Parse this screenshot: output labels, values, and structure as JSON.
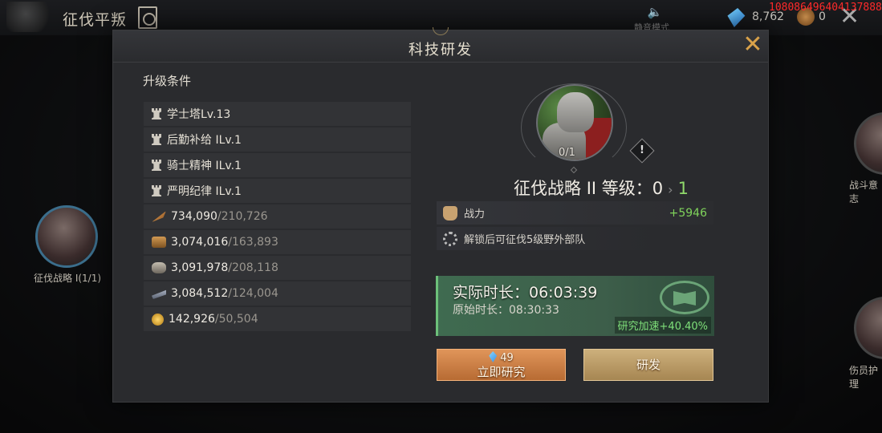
{
  "top_bar": {
    "title": "征伐平叛",
    "mute_label": "静音模式",
    "gems": "8,762",
    "coins": "0",
    "debug_id": "1080864964041378882"
  },
  "side_nodes": {
    "left_label": "征伐战略 I(1/1)",
    "right1_label": "战斗意志",
    "right2_label": "伤员护理"
  },
  "dialog": {
    "title": "科技研发",
    "requirements_title": "升级条件",
    "building_requirements": [
      {
        "icon": "tower-icon",
        "text": "学士塔Lv.13"
      },
      {
        "icon": "tower-icon",
        "text": "后勤补给 ILv.1"
      },
      {
        "icon": "tower-icon",
        "text": "骑士精神 ILv.1"
      },
      {
        "icon": "tower-icon",
        "text": "严明纪律 ILv.1"
      }
    ],
    "resource_requirements": [
      {
        "icon": "feather-icon",
        "color": "#c9863f",
        "have": "734,090",
        "need": "/210,726"
      },
      {
        "icon": "wood-icon",
        "color": "#b8843e",
        "have": "3,074,016",
        "need": "/163,893"
      },
      {
        "icon": "stone-icon",
        "color": "#9a9488",
        "have": "3,091,978",
        "need": "/208,118"
      },
      {
        "icon": "iron-icon",
        "color": "#8b93a3",
        "have": "3,084,512",
        "need": "/124,004"
      },
      {
        "icon": "gold-icon",
        "color": "#e0b43a",
        "have": "142,926",
        "need": "/50,504"
      }
    ],
    "tech": {
      "portrait_progress": "0/1",
      "name": "征伐战略 II 等级：",
      "current_level": "0",
      "next_level": "1",
      "stats": [
        {
          "icon": "fist-icon",
          "label": "战力",
          "value": "+5946"
        },
        {
          "icon": "gear-icon",
          "label": "解锁后可征伐5级野外部队",
          "value": ""
        }
      ]
    },
    "timer": {
      "actual": "实际时长：06:03:39",
      "original": "原始时长：08:30:33",
      "speedup": "研究加速+40.40%"
    },
    "buttons": {
      "instant_cost": "49",
      "instant_label": "立即研究",
      "research_label": "研发"
    }
  }
}
